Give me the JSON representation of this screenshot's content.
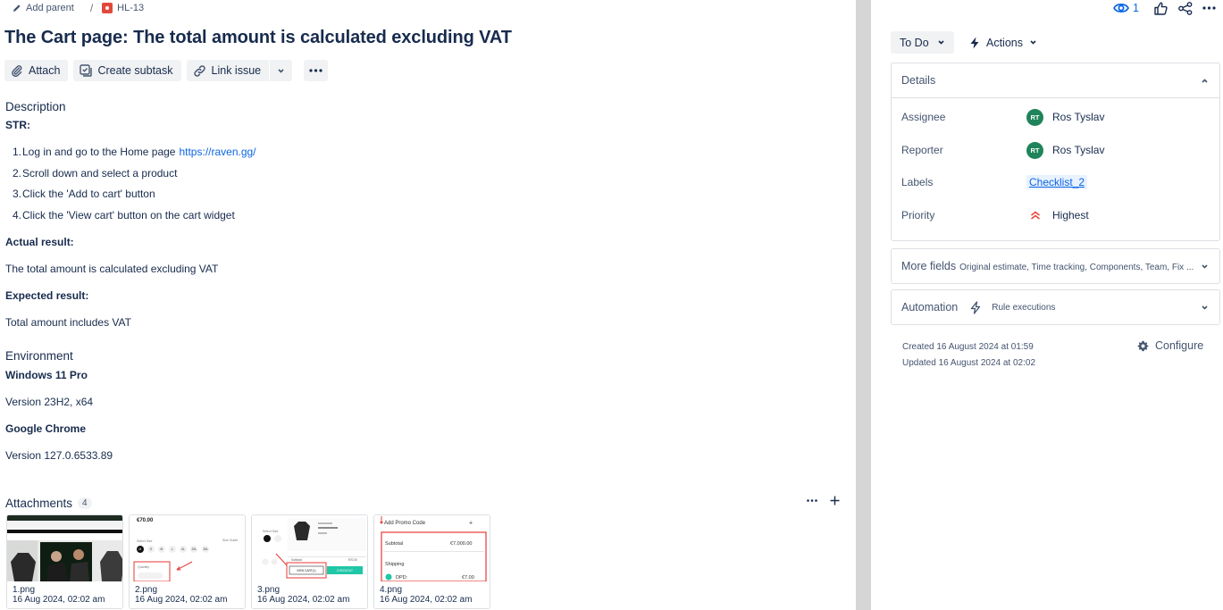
{
  "breadcrumb": {
    "add_parent": "Add parent",
    "separator": "/",
    "issue_key": "HL-13"
  },
  "issue": {
    "title": "The Cart page: The total amount is calculated excluding VAT"
  },
  "toolbar": {
    "attach": "Attach",
    "create_subtask": "Create subtask",
    "link_issue": "Link issue"
  },
  "description": {
    "heading": "Description",
    "str_label": "STR:",
    "steps": [
      {
        "num": "1.",
        "text": "Log in and go to the Home page",
        "link": "https://raven.gg/"
      },
      {
        "num": "2.",
        "text": "Scroll down and select a product"
      },
      {
        "num": "3.",
        "text": "Click the 'Add to cart' button"
      },
      {
        "num": "4.",
        "text": "Click the 'View cart' button on the cart widget"
      }
    ],
    "actual_label": "Actual result:",
    "actual_text": "The total amount is calculated excluding VAT",
    "expected_label": "Expected result:",
    "expected_text": "Total amount includes VAT"
  },
  "environment": {
    "heading": "Environment",
    "os": "Windows 11 Pro",
    "os_version": "Version 23H2, x64",
    "browser": "Google Chrome",
    "browser_version": "Version 127.0.6533.89"
  },
  "attachments": {
    "heading": "Attachments",
    "count": "4",
    "items": [
      {
        "name": "1.png",
        "date": "16 Aug 2024, 02:02 am"
      },
      {
        "name": "2.png",
        "date": "16 Aug 2024, 02:02 am"
      },
      {
        "name": "3.png",
        "date": "16 Aug 2024, 02:02 am"
      },
      {
        "name": "4.png",
        "date": "16 Aug 2024, 02:02 am"
      }
    ],
    "thumb2": {
      "price": "€70.00",
      "select_size": "Select Size",
      "size_guide": "Size Guide",
      "sizes": [
        "M",
        "S",
        "M",
        "L",
        "XL",
        "2XL",
        "3XL"
      ],
      "quantity": "Quantity"
    },
    "thumb3": {
      "select_size": "Select Size",
      "subtotal": "Subtotal",
      "subtotal_value": "€70.00",
      "view_cart": "VIEW CART(1)",
      "checkout": "CHECKOUT"
    },
    "thumb4": {
      "promo": "Add Promo Code",
      "subtotal": "Subtotal",
      "subtotal_value": "€7,000.00",
      "shipping": "Shipping",
      "dpd": "DPD:",
      "dpd_value": "€7.00"
    }
  },
  "header_right": {
    "watchers": "1"
  },
  "status": {
    "label": "To Do",
    "actions": "Actions"
  },
  "details": {
    "heading": "Details",
    "fields": [
      {
        "label": "Assignee",
        "value": "Ros Tyslav",
        "initials": "RT"
      },
      {
        "label": "Reporter",
        "value": "Ros Tyslav",
        "initials": "RT"
      },
      {
        "label": "Labels",
        "value": "Checklist_2"
      },
      {
        "label": "Priority",
        "value": "Highest"
      }
    ]
  },
  "more_fields": {
    "title": "More fields",
    "summary": "Original estimate, Time tracking, Components, Team, Fix ..."
  },
  "automation": {
    "title": "Automation",
    "summary": "Rule executions"
  },
  "meta": {
    "created": "Created 16 August 2024 at 01:59",
    "updated": "Updated 16 August 2024 at 02:02",
    "configure": "Configure"
  },
  "colors": {
    "accent": "#0c66e4",
    "bug": "#e2483d",
    "avatar": "#1f845a",
    "priority": "#e2483d"
  }
}
